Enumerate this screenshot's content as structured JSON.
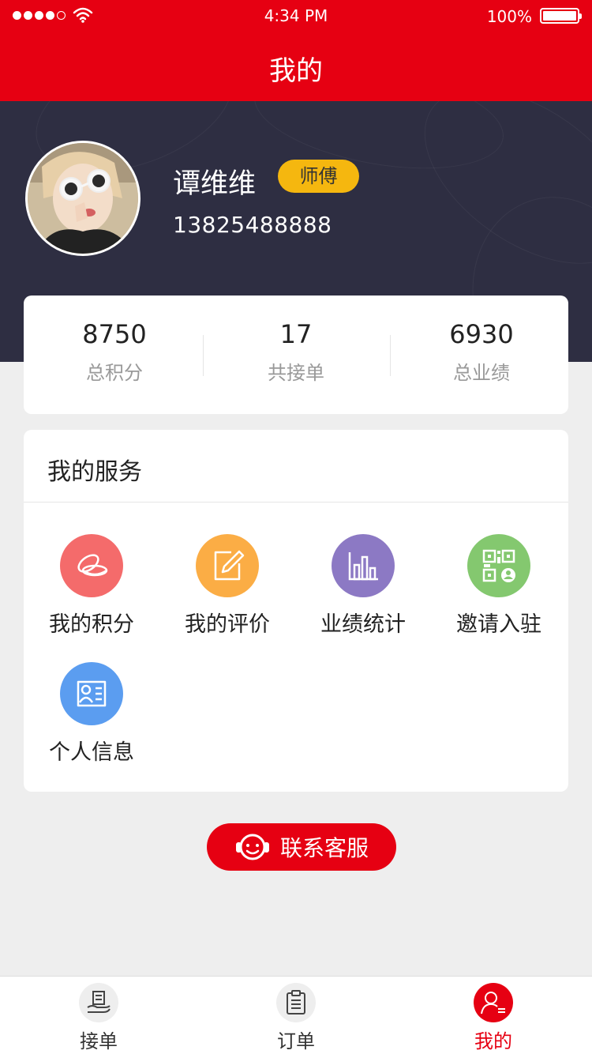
{
  "status_bar": {
    "time": "4:34 PM",
    "battery": "100%"
  },
  "header": {
    "title": "我的"
  },
  "profile": {
    "name": "谭维维",
    "role": "师傅",
    "phone": "13825488888"
  },
  "stats": [
    {
      "value": "8750",
      "label": "总积分"
    },
    {
      "value": "17",
      "label": "共接单"
    },
    {
      "value": "6930",
      "label": "总业绩"
    }
  ],
  "services": {
    "title": "我的服务",
    "items": [
      {
        "label": "我的积分",
        "icon": "coins-icon",
        "color": "#f46b6b"
      },
      {
        "label": "我的评价",
        "icon": "edit-icon",
        "color": "#fbad45"
      },
      {
        "label": "业绩统计",
        "icon": "bar-chart-icon",
        "color": "#8c79c4"
      },
      {
        "label": "邀请入驻",
        "icon": "qr-code-icon",
        "color": "#84c86f"
      },
      {
        "label": "个人信息",
        "icon": "id-card-icon",
        "color": "#5b9df0"
      }
    ]
  },
  "contact_button": {
    "label": "联系客服",
    "icon": "headset-icon"
  },
  "tabbar": {
    "items": [
      {
        "label": "接单",
        "icon": "hand-receive-icon",
        "active": false
      },
      {
        "label": "订单",
        "icon": "clipboard-icon",
        "active": false
      },
      {
        "label": "我的",
        "icon": "user-icon",
        "active": true
      }
    ]
  },
  "colors": {
    "brand": "#e60012",
    "profile_bg": "#2e2e42",
    "badge": "#f5b70f",
    "page_bg": "#eeeeee"
  }
}
